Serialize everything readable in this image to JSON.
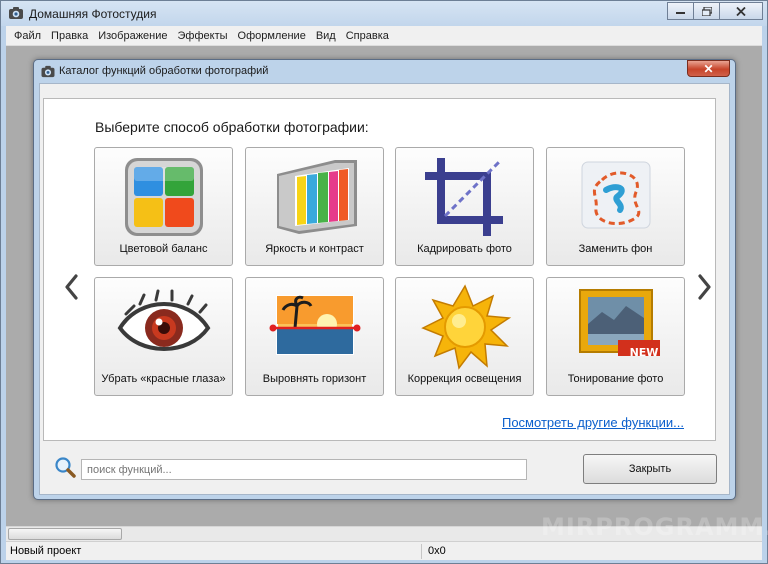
{
  "window": {
    "title": "Домашняя Фотостудия",
    "icon": "camera-icon"
  },
  "menu": [
    "Файл",
    "Правка",
    "Изображение",
    "Эффекты",
    "Оформление",
    "Вид",
    "Справка"
  ],
  "dialog": {
    "title": "Каталог функций обработки фотографий",
    "close_glyph": "✕",
    "heading": "Выберите способ обработки фотографии:",
    "tiles": [
      {
        "label": "Цветовой баланс",
        "icon": "color-balance-icon"
      },
      {
        "label": "Яркость и контраст",
        "icon": "brightness-contrast-icon"
      },
      {
        "label": "Кадрировать фото",
        "icon": "crop-icon"
      },
      {
        "label": "Заменить фон",
        "icon": "replace-background-icon"
      },
      {
        "label": "Убрать «красные глаза»",
        "icon": "red-eye-icon"
      },
      {
        "label": "Выровнять горизонт",
        "icon": "horizon-icon"
      },
      {
        "label": "Коррекция освещения",
        "icon": "sun-icon"
      },
      {
        "label": "Тонирование фото",
        "icon": "toning-icon",
        "badge": "NEW"
      }
    ],
    "more_link": "Посмотреть другие функции...",
    "search_placeholder": "поиск функций...",
    "close_button": "Закрыть"
  },
  "status": {
    "project": "Новый проект",
    "coords": "0x0"
  },
  "watermark": "MIRPROGRAMM.RU",
  "colors": {
    "frame": "#bcd2ea",
    "link": "#0b5fcc",
    "close_red": "#c7442a",
    "workspace": "#ababab"
  }
}
